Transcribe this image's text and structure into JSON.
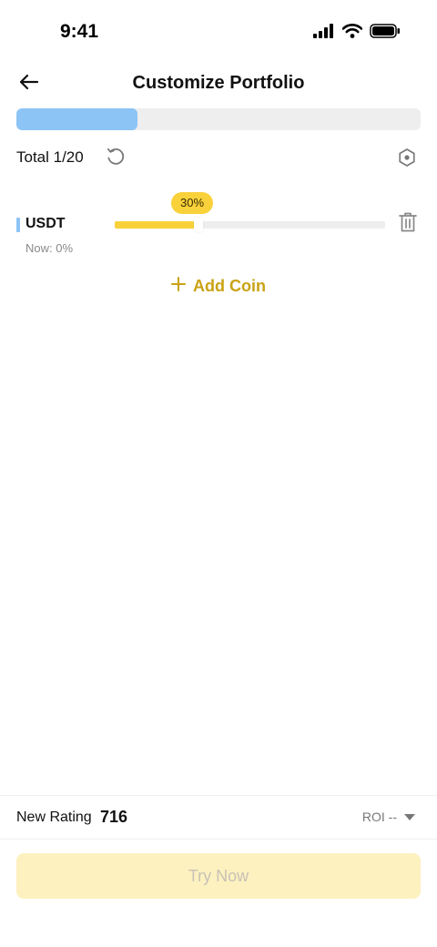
{
  "status_bar": {
    "time": "9:41"
  },
  "header": {
    "title": "Customize Portfolio"
  },
  "total": {
    "label": "Total 1/20",
    "filled_fraction": 0.3
  },
  "coins": [
    {
      "symbol": "USDT",
      "now": "Now: 0%",
      "allocation": "30%",
      "allocation_value": 30,
      "marker_color": "#8cc4f6"
    }
  ],
  "add_coin": {
    "label": "Add Coin"
  },
  "footer": {
    "rating_label": "New Rating",
    "rating_value": "716",
    "roi_label": "ROI --",
    "try_button": "Try Now"
  },
  "colors": {
    "accent_blue": "#8cc4f6",
    "accent_yellow": "#f9d13b",
    "add_coin_text": "#c9a214",
    "try_button_bg": "#fdf1c0"
  },
  "icons": {
    "back": "arrow-left-icon",
    "reset": "reset-icon",
    "settings": "hexagon-settings-icon",
    "delete": "trash-icon",
    "add": "plus-icon"
  }
}
